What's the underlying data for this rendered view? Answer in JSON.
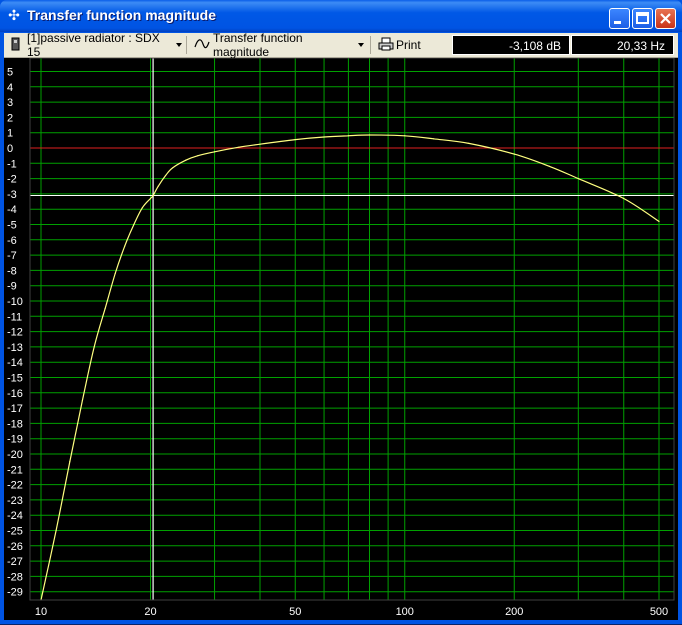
{
  "window": {
    "title": "Transfer function magnitude",
    "icon": "speaker-icon",
    "buttons": [
      "minimize-button",
      "maximize-button",
      "close-button"
    ]
  },
  "toolbar": {
    "project_label": "[1]passive radiator : SDX 15",
    "view_label": "Transfer function magnitude",
    "print_label": "Print",
    "readout_db": "-3,108 dB",
    "readout_hz": "20,33 Hz"
  },
  "colors": {
    "background": "#000000",
    "grid": "#00a000",
    "curve": "#ffff80",
    "zero_line": "#e02020",
    "cursor": "#ffffff"
  },
  "chart_data": {
    "type": "line",
    "title": "",
    "xlabel": "",
    "ylabel": "",
    "x_scale": "log",
    "xlim": [
      10,
      500
    ],
    "ylim": [
      -30,
      5.5
    ],
    "y_ticks": [
      5,
      4,
      3,
      2,
      1,
      0,
      -1,
      -2,
      -3,
      -4,
      -5,
      -6,
      -7,
      -8,
      -9,
      -10,
      -11,
      -12,
      -13,
      -14,
      -15,
      -16,
      -17,
      -18,
      -19,
      -20,
      -21,
      -22,
      -23,
      -24,
      -25,
      -26,
      -27,
      -28,
      -29
    ],
    "x_ticks": [
      10,
      20,
      50,
      100,
      200,
      500
    ],
    "x_minor_ticks": [
      30,
      40,
      60,
      70,
      80,
      90,
      300,
      400
    ],
    "reference_lines": {
      "zero_db": 0,
      "cursor_db": -3.108,
      "cursor_hz": 20.33
    },
    "grid": true,
    "series": [
      {
        "x": [
          10,
          11,
          12,
          13,
          14,
          15,
          16,
          17,
          18,
          19,
          20,
          20.33,
          21,
          22,
          23,
          25,
          27,
          30,
          35,
          40,
          50,
          60,
          70,
          80,
          100,
          120,
          150,
          200,
          250,
          300,
          400,
          500
        ],
        "y": [
          -30,
          -25,
          -20.5,
          -16.5,
          -13,
          -10.5,
          -8.2,
          -6.4,
          -5,
          -3.9,
          -3.3,
          -3.108,
          -2.5,
          -1.8,
          -1.3,
          -0.8,
          -0.5,
          -0.25,
          0.05,
          0.25,
          0.55,
          0.72,
          0.8,
          0.85,
          0.8,
          0.6,
          0.3,
          -0.4,
          -1.2,
          -2.0,
          -3.3,
          -4.8
        ]
      }
    ]
  }
}
